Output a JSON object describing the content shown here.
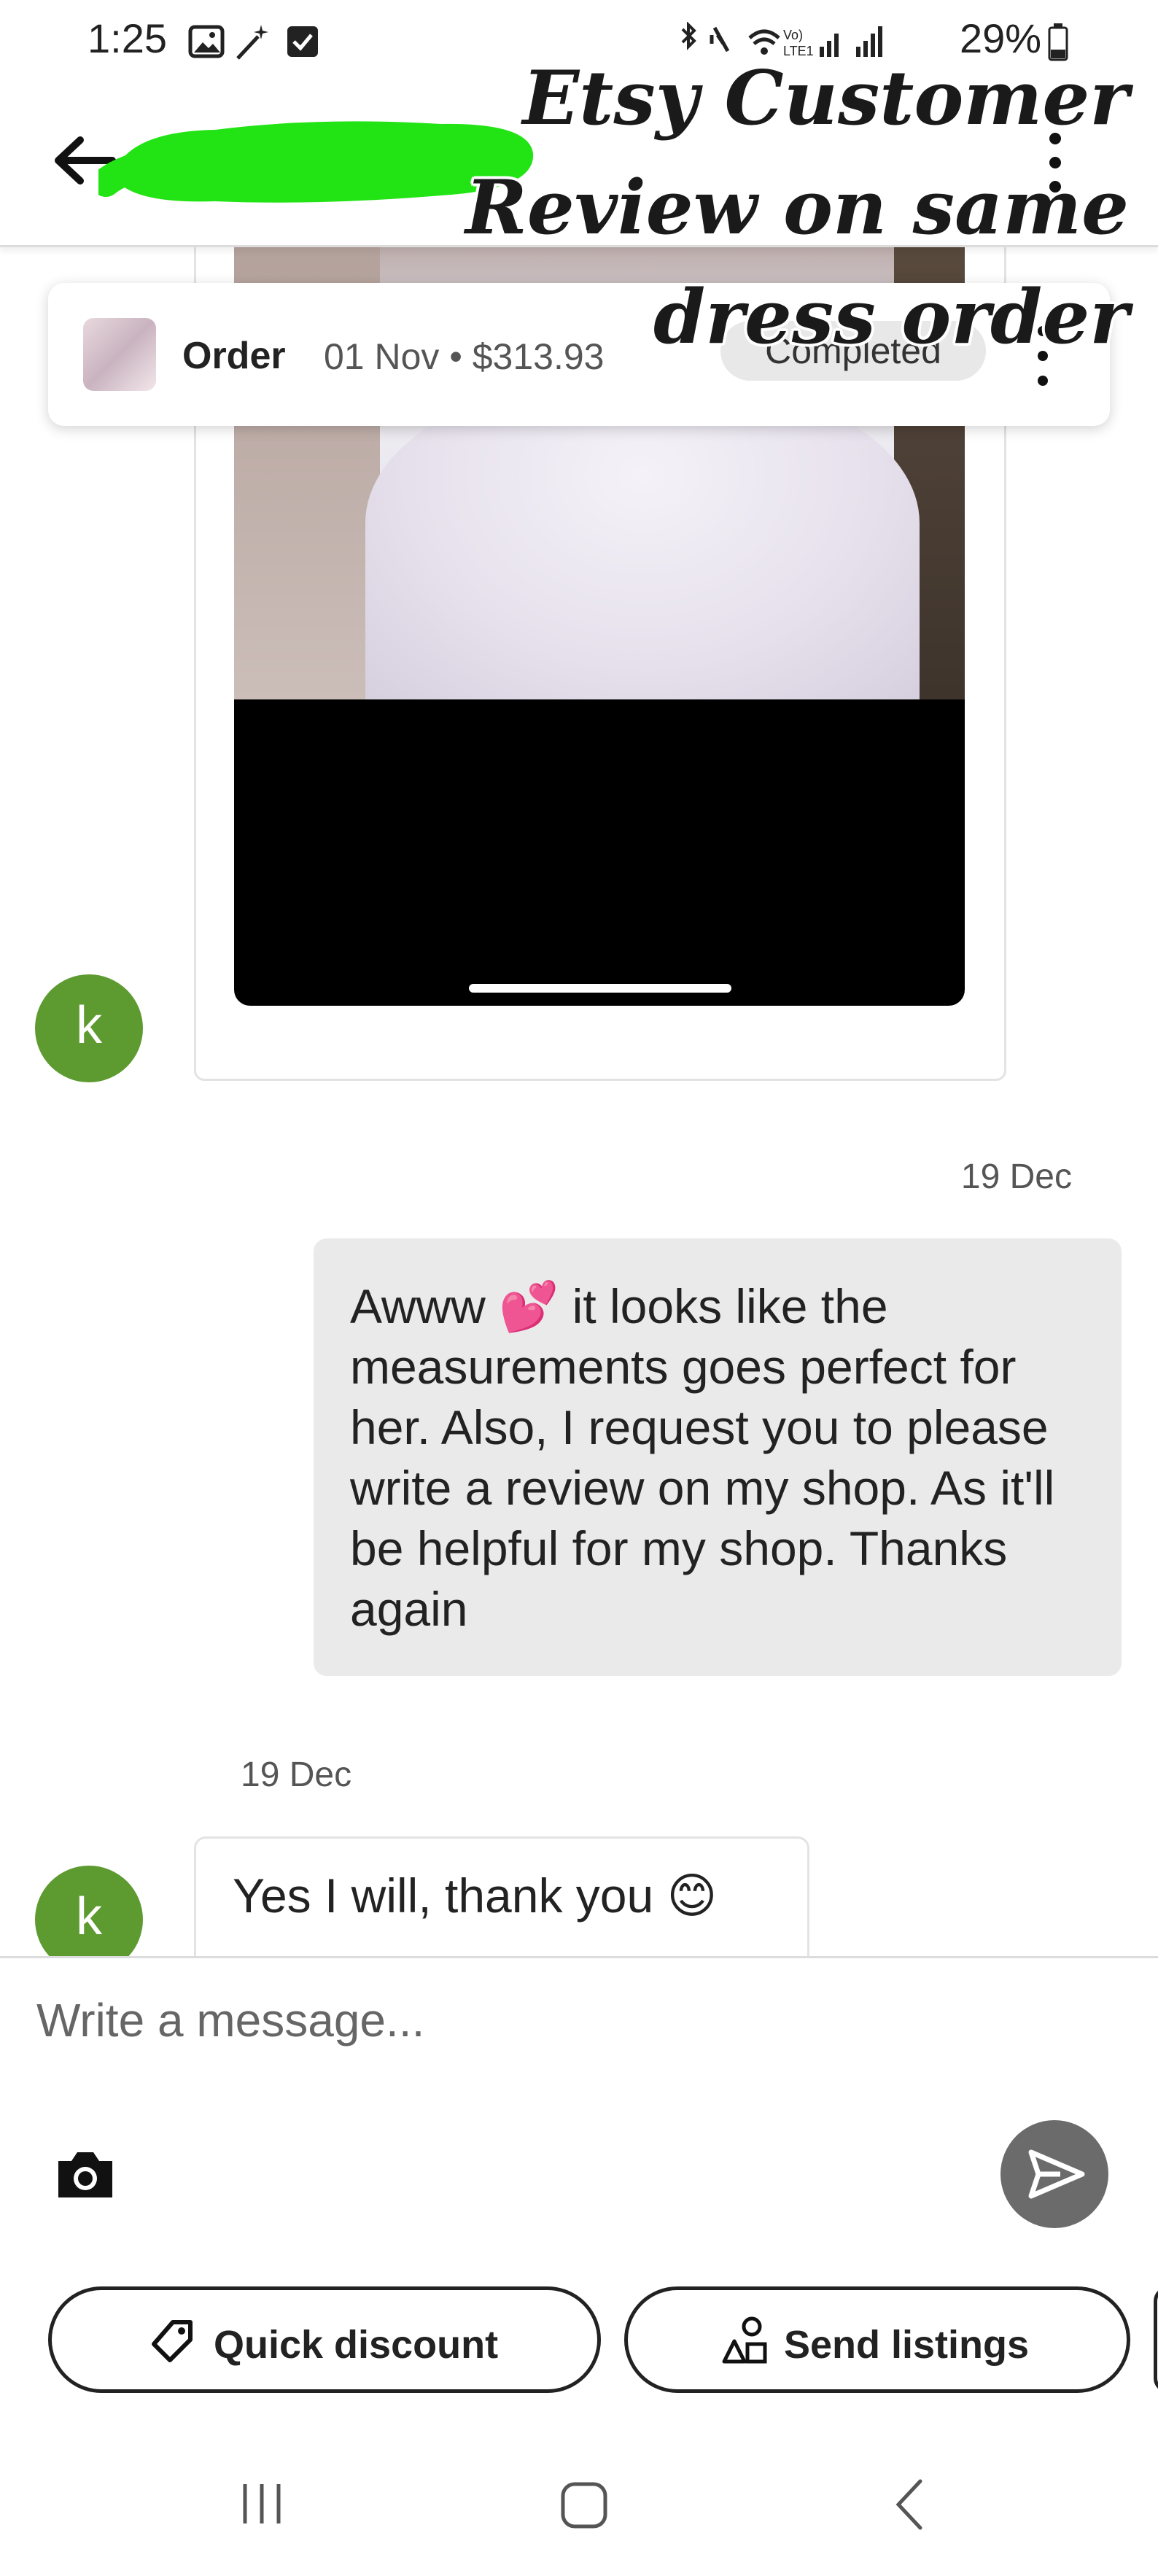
{
  "status_bar": {
    "time": "1:25",
    "battery_percent": "29%"
  },
  "overlay_caption": "Etsy Customer\nReview on same\ndress order",
  "order": {
    "label": "Order",
    "date_price": "01 Nov • $313.93",
    "status": "Completed"
  },
  "messages": {
    "outgoing_date": "19 Dec",
    "outgoing_text": "Awww 💕 it looks like the measurements goes perfect for her. Also, I request you to please write a review on my shop. As it'll be helpful for my shop. Thanks again",
    "incoming_date": "19 Dec",
    "incoming_text": "Yes I will, thank you 😊",
    "avatar_letter": "k"
  },
  "composer": {
    "placeholder": "Write a message...",
    "quick_discount_label": "Quick discount",
    "send_listings_label": "Send listings"
  },
  "colors": {
    "avatar": "#5d9a30",
    "redaction": "#22e314",
    "send_button": "#6b6b6b",
    "bubble_outgoing": "#eaeaea"
  },
  "icons": [
    "back-arrow-icon",
    "kebab-icon",
    "camera-icon",
    "send-icon",
    "tag-icon",
    "shapes-icon",
    "recent-apps-icon",
    "home-icon",
    "back-icon"
  ]
}
